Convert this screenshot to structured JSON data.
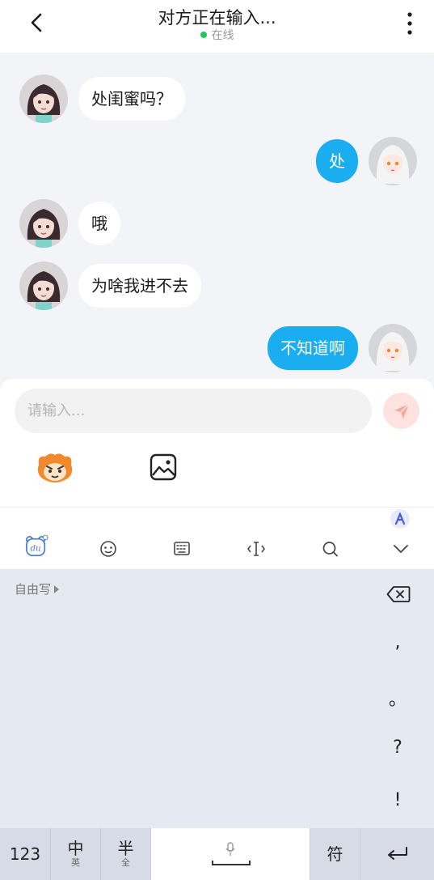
{
  "header": {
    "title": "对方正在输入...",
    "status": "在线"
  },
  "messages": [
    {
      "side": "left",
      "text": "处闺蜜吗？"
    },
    {
      "side": "right",
      "text": "处"
    },
    {
      "side": "left",
      "text": "哦"
    },
    {
      "side": "left",
      "text": "为啥我进不去"
    },
    {
      "side": "right",
      "text": "不知道啊"
    }
  ],
  "composer": {
    "placeholder": "请输入..."
  },
  "keyboard": {
    "freewrite_label": "自由写",
    "punctuation": [
      ",",
      "。",
      "?",
      "!"
    ],
    "keys": {
      "numbers": "123",
      "zh_main": "中",
      "zh_sub": "英",
      "half_main": "半",
      "half_sub": "全",
      "symbols": "符"
    }
  },
  "colors": {
    "accent": "#1aaef0",
    "online": "#22c55e",
    "send": "#f5897a"
  }
}
